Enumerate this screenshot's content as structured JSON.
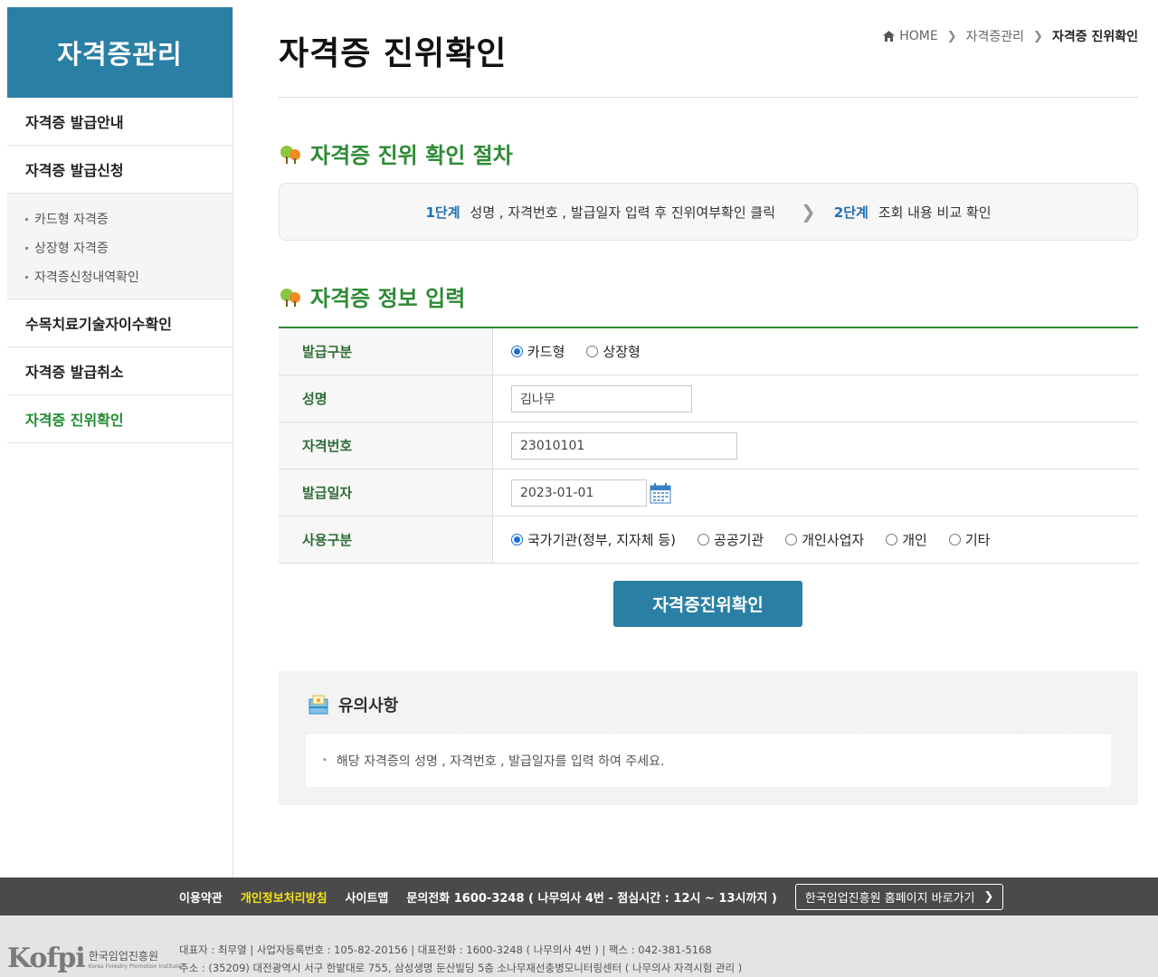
{
  "sidebar": {
    "title": "자격증관리",
    "items": [
      {
        "label": "자격증  발급안내"
      },
      {
        "label": "자격증  발급신청"
      },
      {
        "label": "수목치료기술자이수확인"
      },
      {
        "label": "자격증  발급취소"
      },
      {
        "label": "자격증  진위확인"
      }
    ],
    "submenu": [
      "카드형 자격증",
      "상장형 자격증",
      "자격증신청내역확인"
    ]
  },
  "header": {
    "title": "자격증 진위확인",
    "breadcrumb": {
      "home": "HOME",
      "level1": "자격증관리",
      "current": "자격증 진위확인"
    }
  },
  "procedure": {
    "title": "자격증 진위 확인 절차",
    "step1_label": "1단계",
    "step1_text": "성명 , 자격번호 , 발급일자 입력 후 진위여부확인 클릭",
    "step2_label": "2단계",
    "step2_text": "조회 내용 비교 확인"
  },
  "form": {
    "title": "자격증 정보 입력",
    "issue_type_label": "발급구분",
    "issue_type_options": [
      "카드형",
      "상장형"
    ],
    "name_label": "성명",
    "name_value": "김나무",
    "cert_no_label": "자격번호",
    "cert_no_value": "23010101",
    "issue_date_label": "발급일자",
    "issue_date_value": "2023-01-01",
    "usage_label": "사용구분",
    "usage_options": [
      "국가기관(정부, 지자체 등)",
      "공공기관",
      "개인사업자",
      "개인",
      "기타"
    ],
    "submit_label": "자격증진위확인"
  },
  "notice": {
    "title": "유의사항",
    "text": "해당 자격증의 성명 , 자격번호 , 발급일자를 입력 하여 주세요."
  },
  "footer": {
    "links": [
      "이용약관",
      "개인정보처리방침",
      "사이트맵"
    ],
    "contact": "문의전화 1600-3248 ( 나무의사 4번 - 점심시간 : 12시 ~ 13시까지 )",
    "site_link": "한국임업진흥원 홈페이지 바로가기",
    "info_line1": "대표자 : 최무열 | 사업자등록번호 : 105-82-20156 | 대표전화 : 1600-3248 ( 나무의사 4번 ) | 팩스 : 042-381-5168",
    "info_line2": "주소 : (35209) 대전광역시 서구 한밭대로 755, 삼성생명 둔산빌딩 5층 소나무재선충병모니터링센터 ( 나무의사 자격시험 관리 )",
    "logo_mark": "Kofpi",
    "logo_kor": "한국임업진흥원",
    "logo_eng": "Korea Forestry Promotion Institute"
  },
  "colors": {
    "primary": "#2a7fa4",
    "green": "#2e8b35",
    "step_blue": "#1f6fb5"
  }
}
